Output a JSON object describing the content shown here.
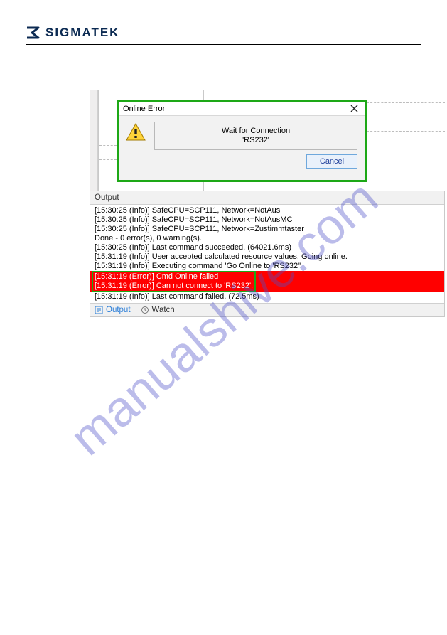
{
  "brand": {
    "name": "SIGMATEK"
  },
  "watermark": "manualshive.com",
  "dialog": {
    "title": "Online Error",
    "msg_line1": "Wait for Connection",
    "msg_line2": "'RS232'",
    "cancel_label": "Cancel"
  },
  "output": {
    "panel_title": "Output",
    "lines": [
      "[15:30:25 (Info)] SafeCPU=SCP111, Network=NotAus",
      "[15:30:25 (Info)] SafeCPU=SCP111, Network=NotAusMC",
      "[15:30:25 (Info)] SafeCPU=SCP111, Network=Zustimmtaster",
      "Done - 0 error(s), 0 warning(s).",
      "[15:30:25 (Info)] Last command succeeded. (64021.6ms)",
      "[15:31:19 (Info)] User accepted calculated resource values. Going online.",
      "[15:31:19 (Info)] Executing command 'Go Online to 'RS232''"
    ],
    "error_lines": [
      "[15:31:19 (Error)] Cmd Online failed",
      "[15:31:19 (Error)] Can not connect to 'RS232'."
    ],
    "trailing_line": "[15:31:19 (Info)] Last command failed. (72.5ms)"
  },
  "tabs": {
    "output": "Output",
    "watch": "Watch"
  },
  "icons": {
    "warning": "warning-icon",
    "close": "close-icon",
    "output_tab": "output-tab-icon",
    "watch_tab": "watch-tab-icon"
  }
}
